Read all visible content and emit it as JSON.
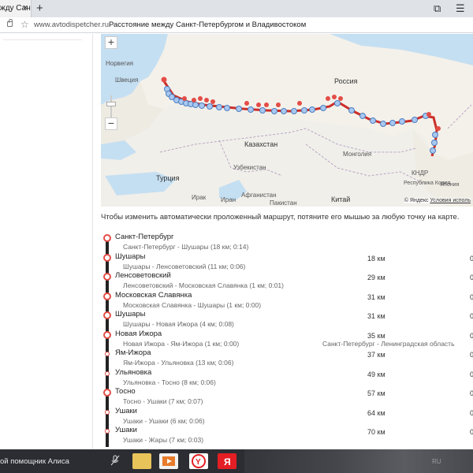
{
  "browser": {
    "tab_title": "жду Сан",
    "tab_close": "×",
    "new_tab": "+",
    "url": "www.avtodispetcher.ru",
    "page_title": "Расстояние между Санкт-Петербургом и Владивостоком"
  },
  "map": {
    "zoom_in": "+",
    "zoom_out": "−",
    "labels": [
      {
        "text": "Норвегия",
        "kind": "country"
      },
      {
        "text": "Швеция",
        "kind": "country"
      },
      {
        "text": "Россия",
        "kind": "country"
      },
      {
        "text": "Казахстан",
        "kind": "country"
      },
      {
        "text": "Узбекистан",
        "kind": "country"
      },
      {
        "text": "Монголия",
        "kind": "country"
      },
      {
        "text": "Турция",
        "kind": "country"
      },
      {
        "text": "Ирак",
        "kind": "country"
      },
      {
        "text": "Иран",
        "kind": "country"
      },
      {
        "text": "Афганистан",
        "kind": "country"
      },
      {
        "text": "Пакистан",
        "kind": "country"
      },
      {
        "text": "Китай",
        "kind": "country"
      },
      {
        "text": "КНДР",
        "kind": "country"
      },
      {
        "text": "Республика Корея",
        "kind": "country"
      },
      {
        "text": "Япония",
        "kind": "country"
      }
    ],
    "copyright": "© Яндекс",
    "terms_link": "Условия исполь"
  },
  "hint": "Чтобы изменить автоматически проложенный маршрут, потяните его мышью за любую точку на карте.",
  "route": [
    {
      "name": "Санкт-Петербург",
      "km": "",
      "extra": "",
      "segment": "Санкт-Петербург - Шушары (18 км; 0:14)",
      "region": "",
      "big": true
    },
    {
      "name": "Шушары",
      "km": "18 км",
      "extra": "0",
      "segment": "Шушары - Ленсоветовский (11 км; 0:06)",
      "region": "",
      "big": true
    },
    {
      "name": "Ленсоветовский",
      "km": "29 км",
      "extra": "0",
      "segment": "Ленсоветовский - Московская Славянка (1 км; 0:01)",
      "region": "",
      "big": true
    },
    {
      "name": "Московская Славянка",
      "km": "31 км",
      "extra": "0",
      "segment": "Московская Славянка - Шушары (1 км; 0:00)",
      "region": "",
      "big": true
    },
    {
      "name": "Шушары",
      "km": "31 км",
      "extra": "0",
      "segment": "Шушары - Новая Ижора (4 км; 0:08)",
      "region": "",
      "big": true
    },
    {
      "name": "Новая Ижора",
      "km": "35 км",
      "extra": "0",
      "segment": "Новая Ижора - Ям-Ижора (1 км; 0:00)",
      "region": "Санкт-Петербург - Ленинградская область",
      "big": true
    },
    {
      "name": "Ям-Ижора",
      "km": "37 км",
      "extra": "0",
      "segment": "Ям-Ижора - Ульяновка (13 км; 0:06)",
      "region": "",
      "big": false
    },
    {
      "name": "Ульяновка",
      "km": "49 км",
      "extra": "0",
      "segment": "Ульяновка - Тосно (8 км; 0:06)",
      "region": "",
      "big": false
    },
    {
      "name": "Тосно",
      "km": "57 км",
      "extra": "0",
      "segment": "Тосно - Ушаки (7 км; 0:07)",
      "region": "",
      "big": true
    },
    {
      "name": "Ушаки",
      "km": "64 км",
      "extra": "0",
      "segment": "Ушаки - Ушаки (6 км; 0:06)",
      "region": "",
      "big": false
    },
    {
      "name": "Ушаки",
      "km": "70 км",
      "extra": "0",
      "segment": "Ушаки - Жары (7 км; 0:03)",
      "region": "",
      "big": false
    }
  ],
  "taskbar": {
    "assistant_text": "ой помощник Алиса",
    "lang": "RU"
  }
}
